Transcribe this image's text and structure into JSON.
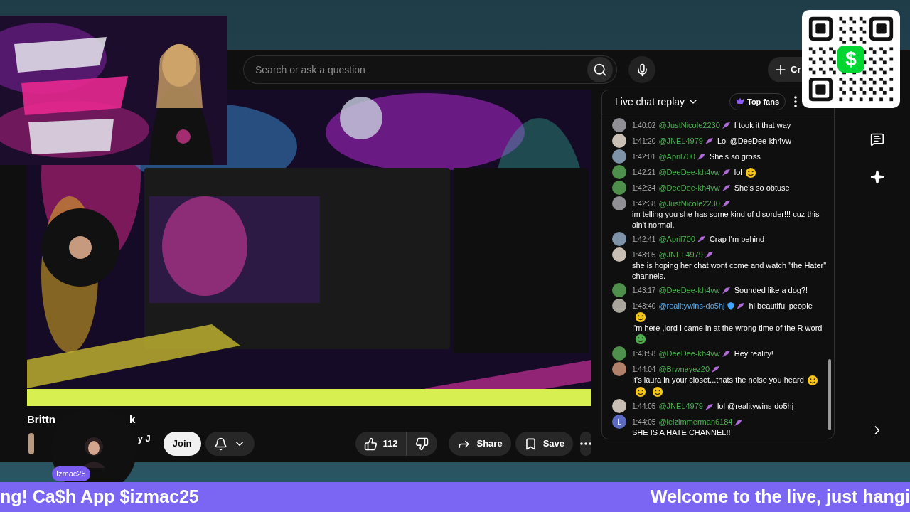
{
  "qr_code": {
    "logo": "$"
  },
  "search": {
    "placeholder": "Search or ask a question"
  },
  "create_button": {
    "label": "Cr"
  },
  "chat": {
    "title": "Live chat replay",
    "top_fans": "Top fans",
    "messages": [
      {
        "time": "1:40:02",
        "user": "@JustNicole2230",
        "moderator": false,
        "color": "#8f8f95",
        "parts": [
          {
            "kind": "text",
            "text": "I took it that way"
          }
        ]
      },
      {
        "time": "1:41:20",
        "user": "@JNEL4979",
        "moderator": false,
        "color": "#c9bfb4",
        "parts": [
          {
            "kind": "text",
            "text": "Lol @DeeDee-kh4vw"
          }
        ]
      },
      {
        "time": "1:42:01",
        "user": "@April700",
        "moderator": false,
        "color": "#7f93a8",
        "parts": [
          {
            "kind": "text",
            "text": "She's so gross"
          }
        ]
      },
      {
        "time": "1:42:21",
        "user": "@DeeDee-kh4vw",
        "moderator": false,
        "color": "#4f8f4c",
        "parts": [
          {
            "kind": "text",
            "text": "lol"
          },
          {
            "kind": "emoji",
            "color": "#f5c518"
          }
        ]
      },
      {
        "time": "1:42:34",
        "user": "@DeeDee-kh4vw",
        "moderator": false,
        "color": "#4f8f4c",
        "parts": [
          {
            "kind": "text",
            "text": "She's so obtuse"
          }
        ]
      },
      {
        "time": "1:42:38",
        "user": "@JustNicole2230",
        "moderator": false,
        "color": "#8f8f95",
        "parts": [
          {
            "kind": "text",
            "text": "im telling you she has some kind of disorder!!! cuz this ain't normal."
          }
        ]
      },
      {
        "time": "1:42:41",
        "user": "@April700",
        "moderator": false,
        "color": "#7f93a8",
        "parts": [
          {
            "kind": "text",
            "text": "Crap I'm behind"
          }
        ]
      },
      {
        "time": "1:43:05",
        "user": "@JNEL4979",
        "moderator": false,
        "color": "#c9bfb4",
        "parts": [
          {
            "kind": "text",
            "text": "she is hoping her chat wont come and watch \"the Hater\" channels."
          }
        ]
      },
      {
        "time": "1:43:17",
        "user": "@DeeDee-kh4vw",
        "moderator": false,
        "color": "#4f8f4c",
        "parts": [
          {
            "kind": "text",
            "text": "Sounded like a dog?!"
          }
        ]
      },
      {
        "time": "1:43:40",
        "user": "@realitywins-do5hj",
        "moderator": true,
        "color": "#a9a49c",
        "parts": [
          {
            "kind": "text",
            "text": "hi beautiful people"
          },
          {
            "kind": "emoji",
            "color": "#f5c518"
          },
          {
            "kind": "text",
            "text": "I'm here ,lord I came in at the wrong time of the R word"
          },
          {
            "kind": "emoji",
            "color": "#4caf50"
          }
        ]
      },
      {
        "time": "1:43:58",
        "user": "@DeeDee-kh4vw",
        "moderator": false,
        "color": "#4f8f4c",
        "parts": [
          {
            "kind": "text",
            "text": "Hey reality!"
          }
        ]
      },
      {
        "time": "1:44:04",
        "user": "@Brwneyez20",
        "moderator": false,
        "color": "#b0806a",
        "parts": [
          {
            "kind": "text",
            "text": "It's laura in your closet...thats the noise you heard"
          },
          {
            "kind": "emoji",
            "color": "#f5c518"
          },
          {
            "kind": "emoji",
            "color": "#f5c518"
          },
          {
            "kind": "emoji",
            "color": "#f5c518"
          }
        ]
      },
      {
        "time": "1:44:05",
        "user": "@JNEL4979",
        "moderator": false,
        "color": "#c9bfb4",
        "parts": [
          {
            "kind": "text",
            "text": "lol @realitywins-do5hj"
          }
        ]
      },
      {
        "time": "1:44:05",
        "user": "@leizimmerman6184",
        "moderator": false,
        "color": "#5c6bc0",
        "letter": "L",
        "parts": [
          {
            "kind": "text",
            "text": "SHE IS A HATE CHANNEL!!"
          }
        ]
      }
    ]
  },
  "video_title": [
    "Brittn",
    "k"
  ],
  "channel": {
    "name": "y J"
  },
  "join_button": "Join",
  "like_count": "112",
  "share_button": "Share",
  "save_button": "Save",
  "camera": {
    "label": "Izmac25"
  },
  "ticker": [
    "ng! Ca$h App $izmac25",
    "Welcome to the live, just hangi"
  ]
}
